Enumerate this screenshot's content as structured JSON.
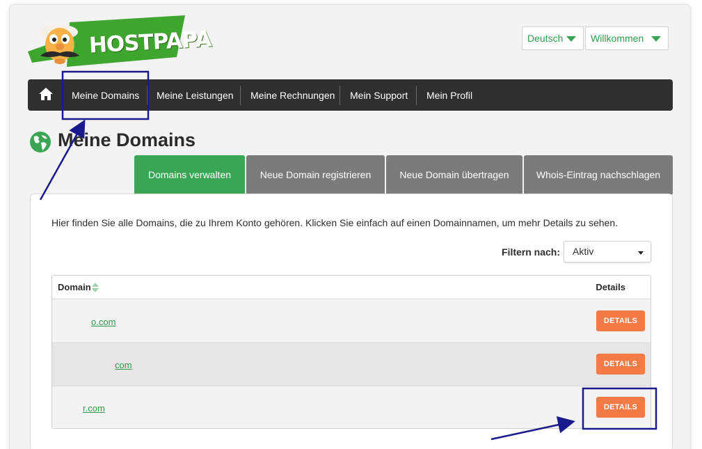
{
  "brand": {
    "name": "HOSTPAPA"
  },
  "header": {
    "language_label": "Deutsch",
    "user_menu_label": "Willkommen"
  },
  "nav": {
    "home_icon": "home-icon",
    "items": [
      {
        "label": "Meine Domains"
      },
      {
        "label": "Meine Leistungen"
      },
      {
        "label": "Meine Rechnungen"
      },
      {
        "label": "Mein Support"
      },
      {
        "label": "Mein Profil"
      }
    ]
  },
  "page": {
    "title": "Meine Domains",
    "title_icon": "globe-icon"
  },
  "tabs": [
    {
      "label": "Domains verwalten",
      "active": true
    },
    {
      "label": "Neue Domain registrieren",
      "active": false
    },
    {
      "label": "Neue Domain übertragen",
      "active": false
    },
    {
      "label": "Whois-Eintrag nachschlagen",
      "active": false
    }
  ],
  "content": {
    "intro": "Hier finden Sie alle Domains, die zu Ihrem Konto gehören. Klicken Sie einfach auf einen Domainnamen, um mehr Details zu sehen.",
    "filter_label": "Filtern nach:",
    "filter_value": "Aktiv"
  },
  "table": {
    "col_domain": "Domain",
    "col_details": "Details",
    "sort_icon": "sort-icon",
    "rows": [
      {
        "domain": "o.com",
        "button": "DETAILS"
      },
      {
        "domain": "com",
        "button": "DETAILS"
      },
      {
        "domain": "r.com",
        "button": "DETAILS"
      }
    ]
  },
  "colors": {
    "brand_green": "#3aa655",
    "nav_dark": "#2f2f2f",
    "accent_orange": "#f47a46",
    "annotation_blue": "#1a1a8c"
  }
}
